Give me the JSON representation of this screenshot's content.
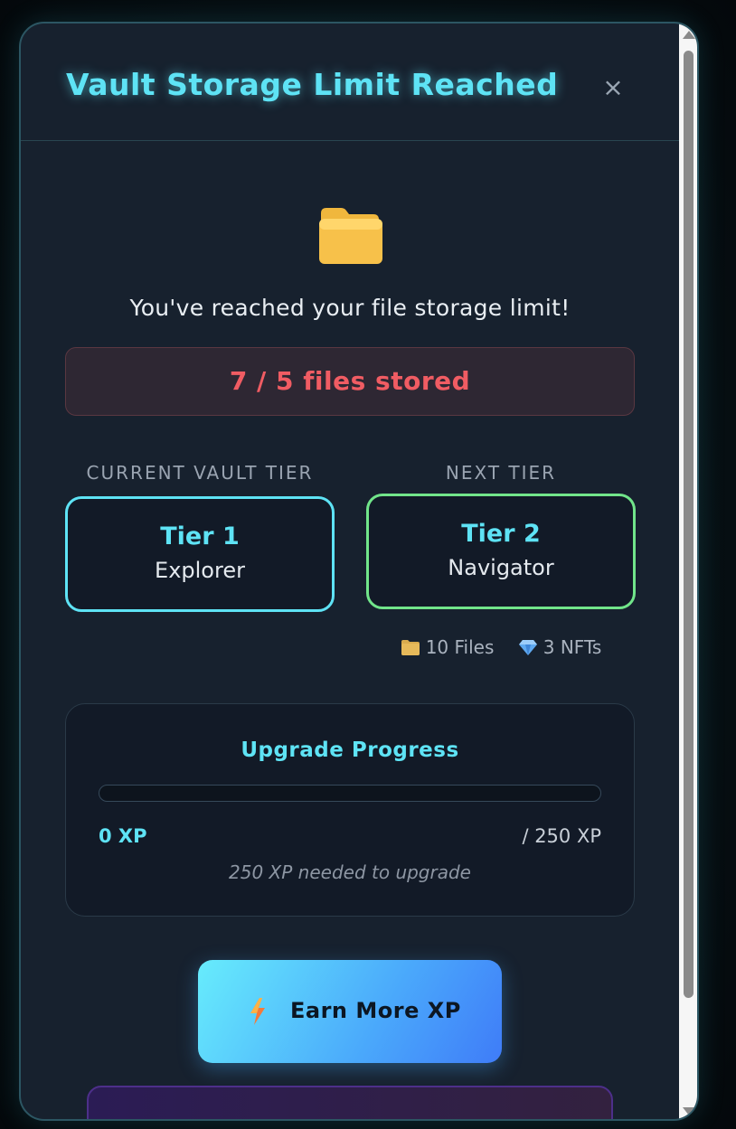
{
  "modal": {
    "title": "Vault Storage Limit Reached",
    "close_label": "×"
  },
  "storage": {
    "message": "You've reached your file storage limit!",
    "usage_text": "7 / 5 files stored",
    "used": 7,
    "limit": 5
  },
  "tiers": {
    "current": {
      "heading": "CURRENT VAULT TIER",
      "tier": "Tier 1",
      "name": "Explorer"
    },
    "next": {
      "heading": "NEXT TIER",
      "tier": "Tier 2",
      "name": "Navigator"
    },
    "next_perks": [
      {
        "icon": "folder-icon",
        "label": "10 Files"
      },
      {
        "icon": "diamond-icon",
        "label": "3 NFTs"
      }
    ]
  },
  "progress": {
    "title": "Upgrade Progress",
    "current_label": "0 XP",
    "target_label": "/ 250 XP",
    "needed_label": "250 XP needed to upgrade",
    "fraction": 0
  },
  "earn_button": {
    "icon": "lightning-bolt-icon",
    "label": "Earn More XP"
  },
  "colors": {
    "accent_cyan": "#5ee3f5",
    "accent_green": "#71e58a",
    "danger": "#f05c63",
    "panel": "#17212e"
  }
}
